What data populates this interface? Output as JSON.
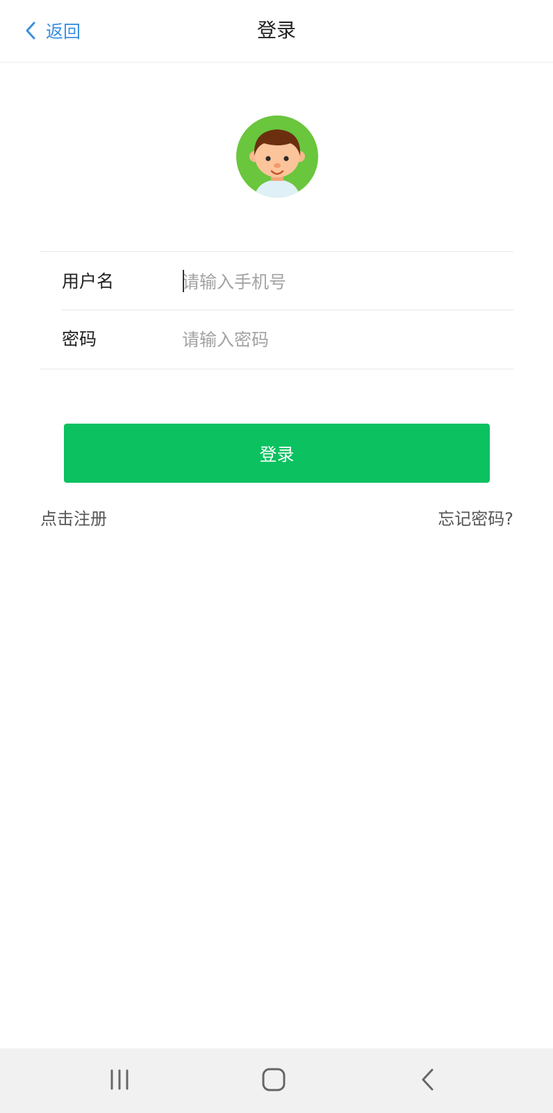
{
  "header": {
    "back_label": "返回",
    "title": "登录"
  },
  "form": {
    "username_label": "用户名",
    "username_placeholder": "请输入手机号",
    "password_label": "密码",
    "password_placeholder": "请输入密码"
  },
  "login_button": "登录",
  "links": {
    "register": "点击注册",
    "forgot": "忘记密码?"
  },
  "colors": {
    "accent_blue": "#3a8ee0",
    "button_green": "#0bc160",
    "avatar_green": "#6ac63d"
  },
  "icons": {
    "back": "chevron-left-icon",
    "avatar": "boy-avatar-icon",
    "nav_recents": "recent-apps-icon",
    "nav_home": "home-icon",
    "nav_back": "back-icon"
  }
}
